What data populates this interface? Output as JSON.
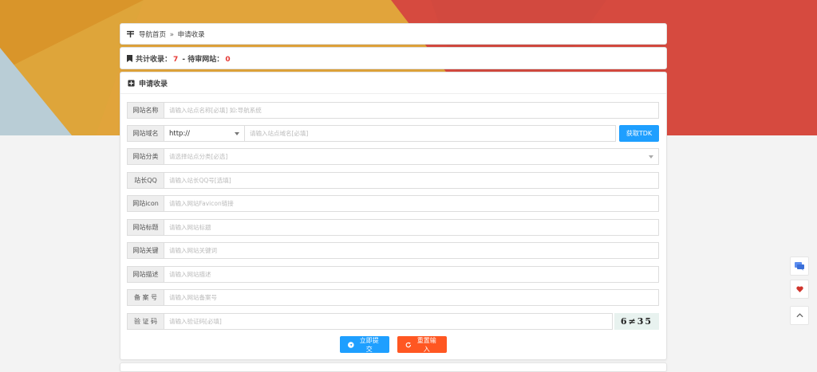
{
  "breadcrumb": {
    "home": "导航首页",
    "separator": "»",
    "current": "申请收录"
  },
  "stats": {
    "total_label": "共计收录：",
    "total_count": "7",
    "dash": " - ",
    "pending_label": "待审网站：",
    "pending_count": "0"
  },
  "form": {
    "title": "申请收录",
    "fields": {
      "name": {
        "label": "网站名称",
        "placeholder": "请输入站点名称[必填] 如:导航系统"
      },
      "domain": {
        "label": "网站域名",
        "protocol": "http://",
        "placeholder": "请输入站点域名[必填]",
        "tdk_button": "获取TDK"
      },
      "category": {
        "label": "网站分类",
        "placeholder": "请选择站点分类[必选]"
      },
      "qq": {
        "label": "站长QQ",
        "placeholder": "请输入站长QQ号[选填]"
      },
      "icon": {
        "label": "网站icon",
        "placeholder": "请输入网站Favicon链接"
      },
      "title": {
        "label": "网站标题",
        "placeholder": "请输入网站标题"
      },
      "keywords": {
        "label": "网站关键",
        "placeholder": "请输入网站关键词"
      },
      "description": {
        "label": "网站描述",
        "placeholder": "请输入网站描述"
      },
      "icp": {
        "label": "备 案 号",
        "placeholder": "请输入网站备案号"
      },
      "captcha": {
        "label": "验 证 码",
        "placeholder": "请输入验证码[必填]",
        "image_text": "6≠35"
      }
    },
    "submit_label": "立即提交",
    "reset_label": "重置输入"
  },
  "colors": {
    "primary": "#1e9fff",
    "danger": "#ff5722",
    "count_red": "#e53935"
  }
}
